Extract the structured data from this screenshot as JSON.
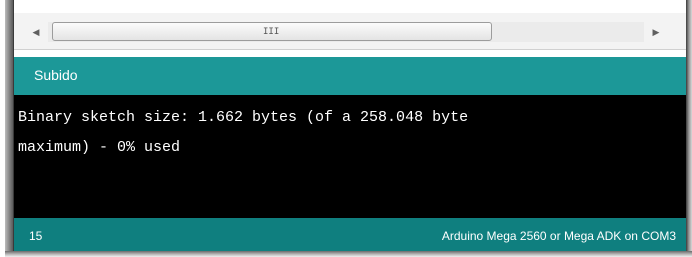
{
  "scrollbar": {
    "left_icon": "scroll-left-arrow",
    "right_icon": "scroll-right-arrow",
    "grip": "III"
  },
  "status": {
    "message": "Subido",
    "color": "#1c9898"
  },
  "console": {
    "output": "Binary sketch size: 1.662 bytes (of a 258.048 byte\nmaximum) - 0% used"
  },
  "footer": {
    "line_number": "15",
    "board": "Arduino Mega 2560 or Mega ADK on COM3",
    "color": "#0f7f7f"
  }
}
